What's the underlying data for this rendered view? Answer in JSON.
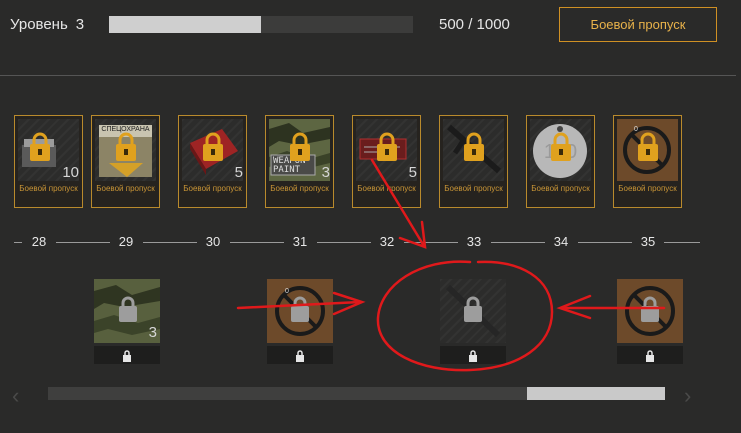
{
  "header": {
    "level_label": "Уровень",
    "level_value": "3",
    "xp_text": "500 / 1000",
    "xp_progress": 0.5,
    "battle_pass_button": "Боевой пропуск"
  },
  "rewards": [
    {
      "level": "28",
      "caption": "Боевой пропуск",
      "qty": "10",
      "item_icon": "ammo-box-icon"
    },
    {
      "level": "29",
      "caption": "Боевой пропуск",
      "qty": "",
      "item_icon": "armor-vest-icon",
      "art_text": "СПЕЦОХРАНА"
    },
    {
      "level": "30",
      "caption": "Боевой пропуск",
      "qty": "5",
      "item_icon": "red-case-icon"
    },
    {
      "level": "31",
      "caption": "Боевой пропуск",
      "qty": "3",
      "item_icon": "weapon-paint-icon",
      "art_text": "WEAPON PAINT"
    },
    {
      "level": "32",
      "caption": "Боевой пропуск",
      "qty": "5",
      "item_icon": "document-case-icon"
    },
    {
      "level": "33",
      "caption": "Боевой пропуск",
      "qty": "",
      "item_icon": "rifle-icon"
    },
    {
      "level": "34",
      "caption": "Боевой пропуск",
      "qty": "",
      "item_icon": "dog-tag-icon",
      "art_text": "100"
    },
    {
      "level": "35",
      "caption": "Боевой пропуск",
      "qty": "",
      "item_icon": "banned-sign-icon"
    }
  ],
  "bonus_rewards": [
    {
      "level": "29",
      "qty": "3",
      "item_icon": "camo-pattern-icon"
    },
    {
      "level": "31",
      "qty": "",
      "item_icon": "banned-sign-icon"
    },
    {
      "level": "33",
      "qty": "",
      "item_icon": "rifle-icon"
    },
    {
      "level": "35",
      "qty": "",
      "item_icon": "banned-sign-icon"
    }
  ],
  "scroll": {
    "thumb_start": 0.777,
    "thumb_end": 1.0
  },
  "colors": {
    "accent": "#cf9024",
    "annotation": "#e0191b"
  }
}
